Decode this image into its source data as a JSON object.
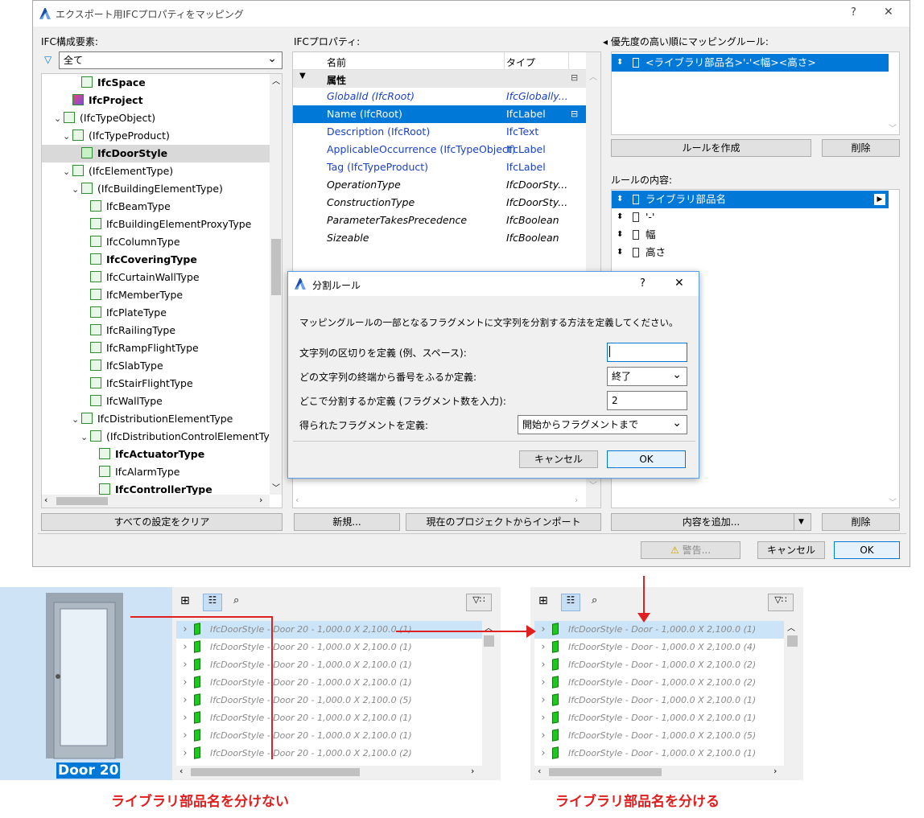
{
  "window": {
    "title": "エクスポート用IFCプロパティをマッピング",
    "help": "?",
    "close": "✕"
  },
  "left": {
    "header": "IFC構成要素:",
    "filter_value": "全て",
    "tree": [
      {
        "label": "IfcSpace",
        "depth": 3,
        "bold": true,
        "chev": "",
        "icon": "space-icon"
      },
      {
        "label": "IfcProject",
        "depth": 2,
        "bold": true,
        "chev": "",
        "icon": "project-icon"
      },
      {
        "label": "(IfcTypeObject)",
        "depth": 1,
        "bold": false,
        "chev": "⌄",
        "icon": "type-icon"
      },
      {
        "label": "(IfcTypeProduct)",
        "depth": 2,
        "bold": false,
        "chev": "⌄",
        "icon": "type-icon"
      },
      {
        "label": "IfcDoorStyle",
        "depth": 3,
        "bold": true,
        "chev": "",
        "icon": "door-icon",
        "selected": true
      },
      {
        "label": "(IfcElementType)",
        "depth": 2,
        "bold": false,
        "chev": "⌄",
        "icon": "element-icon"
      },
      {
        "label": "(IfcBuildingElementType)",
        "depth": 3,
        "bold": false,
        "chev": "⌄",
        "icon": "element-icon"
      },
      {
        "label": "IfcBeamType",
        "depth": 4,
        "bold": false,
        "chev": "",
        "icon": "beam-icon"
      },
      {
        "label": "IfcBuildingElementProxyType",
        "depth": 4,
        "bold": false,
        "chev": "",
        "icon": "proxy-icon"
      },
      {
        "label": "IfcColumnType",
        "depth": 4,
        "bold": false,
        "chev": "",
        "icon": "column-icon"
      },
      {
        "label": "IfcCoveringType",
        "depth": 4,
        "bold": true,
        "chev": "",
        "icon": "covering-icon"
      },
      {
        "label": "IfcCurtainWallType",
        "depth": 4,
        "bold": false,
        "chev": "",
        "icon": "curtainwall-icon"
      },
      {
        "label": "IfcMemberType",
        "depth": 4,
        "bold": false,
        "chev": "",
        "icon": "member-icon"
      },
      {
        "label": "IfcPlateType",
        "depth": 4,
        "bold": false,
        "chev": "",
        "icon": "plate-icon"
      },
      {
        "label": "IfcRailingType",
        "depth": 4,
        "bold": false,
        "chev": "",
        "icon": "railing-icon"
      },
      {
        "label": "IfcRampFlightType",
        "depth": 4,
        "bold": false,
        "chev": "",
        "icon": "ramp-icon"
      },
      {
        "label": "IfcSlabType",
        "depth": 4,
        "bold": false,
        "chev": "",
        "icon": "slab-icon"
      },
      {
        "label": "IfcStairFlightType",
        "depth": 4,
        "bold": false,
        "chev": "",
        "icon": "stair-icon"
      },
      {
        "label": "IfcWallType",
        "depth": 4,
        "bold": false,
        "chev": "",
        "icon": "wall-icon"
      },
      {
        "label": "IfcDistributionElementType",
        "depth": 3,
        "bold": false,
        "chev": "⌄",
        "icon": "distribution-icon"
      },
      {
        "label": "(IfcDistributionControlElementTy",
        "depth": 4,
        "bold": false,
        "chev": "⌄",
        "icon": "distribution-icon"
      },
      {
        "label": "IfcActuatorType",
        "depth": 5,
        "bold": true,
        "chev": "",
        "icon": "distribution-icon"
      },
      {
        "label": "IfcAlarmType",
        "depth": 5,
        "bold": false,
        "chev": "",
        "icon": "distribution-icon"
      },
      {
        "label": "IfcControllerType",
        "depth": 5,
        "bold": true,
        "chev": "",
        "icon": "distribution-icon"
      }
    ],
    "clear_button": "すべての設定をクリア"
  },
  "middle": {
    "header": "IFCプロパティ:",
    "col_name": "名前",
    "col_type": "タイプ",
    "group": "属性",
    "rows": [
      {
        "name": "GlobalId (IfcRoot)",
        "type": "IfcGlobally...",
        "style": "blue it"
      },
      {
        "name": "Name (IfcRoot)",
        "type": "IfcLabel",
        "style": "blue",
        "selected": true
      },
      {
        "name": "Description (IfcRoot)",
        "type": "IfcText",
        "style": "blue"
      },
      {
        "name": "ApplicableOccurrence (IfcTypeObject)",
        "type": "IfcLabel",
        "style": "blue"
      },
      {
        "name": "Tag (IfcTypeProduct)",
        "type": "IfcLabel",
        "style": "blue"
      },
      {
        "name": "OperationType",
        "type": "IfcDoorSty...",
        "style": "it"
      },
      {
        "name": "ConstructionType",
        "type": "IfcDoorSty...",
        "style": "it"
      },
      {
        "name": "ParameterTakesPrecedence",
        "type": "IfcBoolean",
        "style": "it"
      },
      {
        "name": "Sizeable",
        "type": "IfcBoolean",
        "style": "it"
      }
    ],
    "new_button": "新規...",
    "import_button": "現在のプロジェクトからインポート"
  },
  "right": {
    "header": "優先度の高い順にマッピングルール:",
    "rule": "<ライブラリ部品名>'-'<幅><高さ>",
    "create_button": "ルールを作成",
    "delete_button": "削除",
    "content_header": "ルールの内容:",
    "content_items": [
      {
        "label": "ライブラリ部品名",
        "icon": "door-icon"
      },
      {
        "label": "'-'",
        "icon": "text-icon"
      },
      {
        "label": "幅",
        "icon": "door-icon"
      },
      {
        "label": "高さ",
        "icon": "door-icon"
      }
    ],
    "add_button": "内容を追加...",
    "delete2_button": "削除"
  },
  "footer": {
    "warning_button": "警告...",
    "cancel_button": "キャンセル",
    "ok_button": "OK"
  },
  "dialog": {
    "title": "分割ルール",
    "help": "?",
    "close": "✕",
    "description": "マッピングルールの一部となるフラグメントに文字列を分割する方法を定義してください。",
    "label1": "文字列の区切りを定義 (例、スペース):",
    "value1": "",
    "label2": "どの文字列の終端から番号をふるか定義:",
    "value2": "終了",
    "label3": "どこで分割するか定義 (フラグメント数を入力):",
    "value3": "2",
    "label4": "得られたフラグメントを定義:",
    "value4": "開始からフラグメントまで",
    "cancel": "キャンセル",
    "ok": "OK"
  },
  "lower_left": {
    "door_label": "Door 20",
    "rows": [
      "IfcDoorStyle - Door 20 - 1,000.0 X 2,100.0 (1)",
      "IfcDoorStyle - Door 20 - 1,000.0 X 2,100.0 (1)",
      "IfcDoorStyle - Door 20 - 1,000.0 X 2,100.0 (1)",
      "IfcDoorStyle - Door 20 - 1,000.0 X 2,100.0 (1)",
      "IfcDoorStyle - Door 20 - 1,000.0 X 2,100.0 (5)",
      "IfcDoorStyle - Door 20 - 1,000.0 X 2,100.0 (1)",
      "IfcDoorStyle - Door 20 - 1,000.0 X 2,100.0 (1)",
      "IfcDoorStyle - Door 20 - 1,000.0 X 2,100.0 (2)"
    ],
    "caption": "ライブラリ部品名を分けない"
  },
  "lower_right": {
    "rows": [
      "IfcDoorStyle - Door - 1,000.0 X 2,100.0 (1)",
      "IfcDoorStyle - Door - 1,000.0 X 2,100.0 (4)",
      "IfcDoorStyle - Door - 1,000.0 X 2,100.0 (2)",
      "IfcDoorStyle - Door - 1,000.0 X 2,100.0 (2)",
      "IfcDoorStyle - Door - 1,000.0 X 2,100.0 (1)",
      "IfcDoorStyle - Door - 1,000.0 X 2,100.0 (1)",
      "IfcDoorStyle - Door - 1,000.0 X 2,100.0 (5)",
      "IfcDoorStyle - Door - 1,000.0 X 2,100.0 (1)"
    ],
    "caption": "ライブラリ部品名を分ける"
  },
  "colors": {
    "accent": "#0078d7",
    "annotation": "#e02020",
    "door_green": "#1fc81f"
  }
}
